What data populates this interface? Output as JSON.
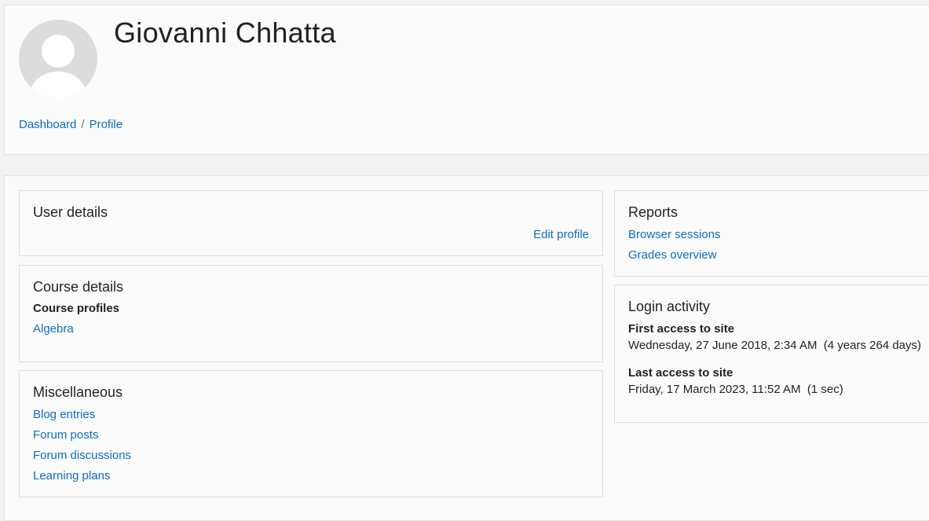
{
  "profile": {
    "name": "Giovanni Chhatta"
  },
  "breadcrumb": {
    "items": [
      "Dashboard",
      "Profile"
    ],
    "separator": "/"
  },
  "user_details": {
    "title": "User details",
    "edit_label": "Edit profile"
  },
  "course_details": {
    "title": "Course details",
    "subheading": "Course profiles",
    "courses": [
      "Algebra"
    ]
  },
  "misc": {
    "title": "Miscellaneous",
    "links": [
      "Blog entries",
      "Forum posts",
      "Forum discussions",
      "Learning plans"
    ]
  },
  "reports": {
    "title": "Reports",
    "links": [
      "Browser sessions",
      "Grades overview"
    ]
  },
  "login_activity": {
    "title": "Login activity",
    "first_label": "First access to site",
    "first_value": "Wednesday, 27 June 2018, 2:34 AM  (4 years 264 days)",
    "last_label": "Last access to site",
    "last_value": "Friday, 17 March 2023, 11:52 AM  (1 sec)"
  },
  "colors": {
    "link": "#0f6cbf",
    "text": "#1d2125",
    "background": "#f2f2f2"
  }
}
